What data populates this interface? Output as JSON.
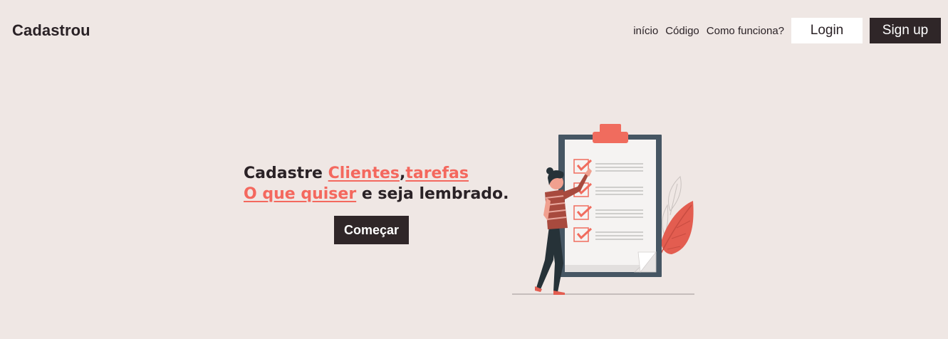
{
  "brand": {
    "name": "Cadastrou"
  },
  "nav": {
    "links": [
      {
        "label": "início"
      },
      {
        "label": "Código"
      },
      {
        "label": "Como funciona?"
      }
    ],
    "login_label": "Login",
    "signup_label": "Sign up"
  },
  "hero": {
    "line1_prefix": "Cadastre ",
    "link1": "Clientes",
    "comma": ",",
    "link2": "tarefas",
    "link3": "O que quiser",
    "line2_suffix": " e seja lembrado.",
    "cta_label": "Começar"
  },
  "colors": {
    "background": "#efe7e4",
    "dark": "#2f2628",
    "accent": "#f4685e",
    "illustration_dark": "#465663"
  },
  "illustration": {
    "icon": "checklist-illustration"
  }
}
